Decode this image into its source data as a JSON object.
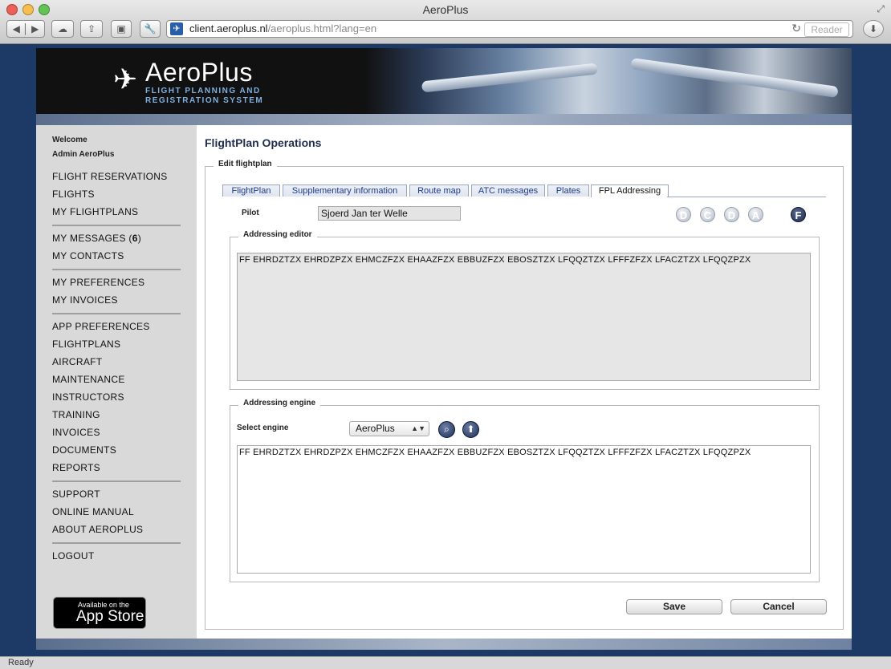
{
  "window": {
    "title": "AeroPlus",
    "url_host": "client.aeroplus.nl",
    "url_path": "/aeroplus.html?lang=en",
    "reader_label": "Reader",
    "status": "Ready"
  },
  "banner": {
    "app_name": "AeroPlus",
    "tagline_line1": "FLIGHT PLANNING AND",
    "tagline_line2": "REGISTRATION SYSTEM"
  },
  "sidebar": {
    "welcome": "Welcome",
    "user": "Admin AeroPlus",
    "groups": [
      [
        "FLIGHT RESERVATIONS",
        "FLIGHTS",
        "MY FLIGHTPLANS"
      ],
      [
        "MY MESSAGES",
        "MY CONTACTS"
      ],
      [
        "MY PREFERENCES",
        "MY INVOICES"
      ],
      [
        "APP PREFERENCES",
        "FLIGHTPLANS",
        "AIRCRAFT",
        "MAINTENANCE",
        "INSTRUCTORS",
        "TRAINING",
        "INVOICES",
        "DOCUMENTS",
        "REPORTS"
      ],
      [
        "SUPPORT",
        "ONLINE MANUAL",
        "ABOUT AEROPLUS"
      ],
      [
        "LOGOUT"
      ]
    ],
    "messages_count": "6",
    "appstore_small": "Available on the",
    "appstore_big": "App Store"
  },
  "main": {
    "title": "FlightPlan Operations",
    "section_legend": "Edit flightplan",
    "tabs": [
      "FlightPlan",
      "Supplementary information",
      "Route map",
      "ATC messages",
      "Plates",
      "FPL Addressing"
    ],
    "active_tab": "FPL Addressing",
    "pilot_label": "Pilot",
    "pilot_value": "Sjoerd Jan ter Welle",
    "status_circles": [
      "D",
      "C",
      "D",
      "A"
    ],
    "status_active": "F",
    "addressing_editor_legend": "Addressing editor",
    "addressing_editor_text": "FF EHRDZTZX EHRDZPZX EHMCZFZX EHAAZFZX EBBUZFZX EBOSZTZX LFQQZTZX LFFFZFZX LFACZTZX LFQQZPZX",
    "addressing_engine_legend": "Addressing engine",
    "select_engine_label": "Select engine",
    "engine_value": "AeroPlus",
    "engine_output_text": "FF EHRDZTZX EHRDZPZX EHMCZFZX EHAAZFZX EBBUZFZX EBOSZTZX LFQQZTZX LFFFZFZX LFACZTZX LFQQZPZX",
    "save_label": "Save",
    "cancel_label": "Cancel"
  },
  "colors": {
    "page_background": "#1d3a66",
    "title_blue": "#1f2d4d",
    "tab_text": "#1a3d8f"
  }
}
